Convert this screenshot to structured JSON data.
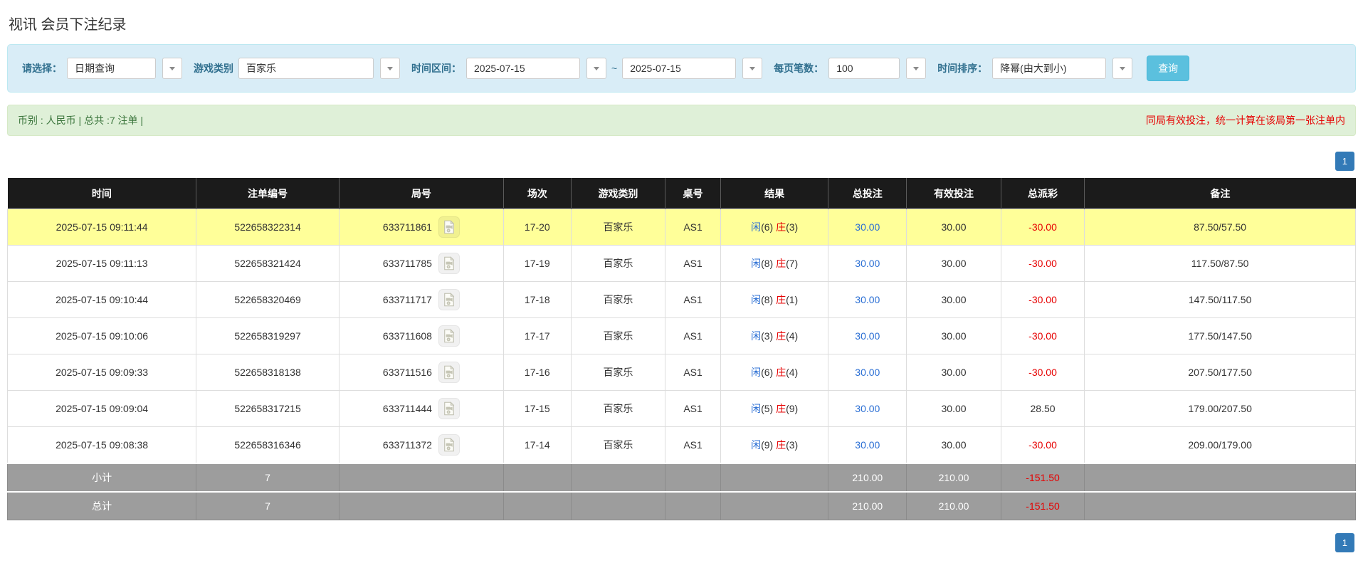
{
  "title": "视讯 会员下注纪录",
  "filters": {
    "select_label": "请选择：",
    "select_value": "日期查询",
    "game_label": "游戏类别",
    "game_value": "百家乐",
    "range_label": "时间区间：",
    "date_from": "2025-07-15",
    "range_separator": "~",
    "date_to": "2025-07-15",
    "per_page_label": "每页笔数：",
    "per_page_value": "100",
    "sort_label": "时间排序：",
    "sort_value": "降幂(由大到小)",
    "search_button": "查询"
  },
  "summary_bar": {
    "left": "币别 : 人民币 | 总共 :7 注单 |",
    "right": "同局有效投注，统一计算在该局第一张注单内"
  },
  "pagination": {
    "page": "1"
  },
  "table": {
    "headers": [
      "时间",
      "注单编号",
      "局号",
      "场次",
      "游戏类别",
      "桌号",
      "结果",
      "总投注",
      "有效投注",
      "总派彩",
      "备注"
    ],
    "rows": [
      {
        "time": "2025-07-15 09:11:44",
        "bet_no": "522658322314",
        "round_no": "633711861",
        "session": "17-20",
        "game": "百家乐",
        "table_no": "AS1",
        "result_player": "闲",
        "result_player_n": "(6)",
        "result_banker": "庄",
        "result_banker_n": "(3)",
        "total_bet": "30.00",
        "valid_bet": "30.00",
        "payout": "-30.00",
        "payout_negative": true,
        "remark": "87.50/57.50",
        "highlight": true
      },
      {
        "time": "2025-07-15 09:11:13",
        "bet_no": "522658321424",
        "round_no": "633711785",
        "session": "17-19",
        "game": "百家乐",
        "table_no": "AS1",
        "result_player": "闲",
        "result_player_n": "(8)",
        "result_banker": "庄",
        "result_banker_n": "(7)",
        "total_bet": "30.00",
        "valid_bet": "30.00",
        "payout": "-30.00",
        "payout_negative": true,
        "remark": "117.50/87.50",
        "highlight": false
      },
      {
        "time": "2025-07-15 09:10:44",
        "bet_no": "522658320469",
        "round_no": "633711717",
        "session": "17-18",
        "game": "百家乐",
        "table_no": "AS1",
        "result_player": "闲",
        "result_player_n": "(8)",
        "result_banker": "庄",
        "result_banker_n": "(1)",
        "total_bet": "30.00",
        "valid_bet": "30.00",
        "payout": "-30.00",
        "payout_negative": true,
        "remark": "147.50/117.50",
        "highlight": false
      },
      {
        "time": "2025-07-15 09:10:06",
        "bet_no": "522658319297",
        "round_no": "633711608",
        "session": "17-17",
        "game": "百家乐",
        "table_no": "AS1",
        "result_player": "闲",
        "result_player_n": "(3)",
        "result_banker": "庄",
        "result_banker_n": "(4)",
        "total_bet": "30.00",
        "valid_bet": "30.00",
        "payout": "-30.00",
        "payout_negative": true,
        "remark": "177.50/147.50",
        "highlight": false
      },
      {
        "time": "2025-07-15 09:09:33",
        "bet_no": "522658318138",
        "round_no": "633711516",
        "session": "17-16",
        "game": "百家乐",
        "table_no": "AS1",
        "result_player": "闲",
        "result_player_n": "(6)",
        "result_banker": "庄",
        "result_banker_n": "(4)",
        "total_bet": "30.00",
        "valid_bet": "30.00",
        "payout": "-30.00",
        "payout_negative": true,
        "remark": "207.50/177.50",
        "highlight": false
      },
      {
        "time": "2025-07-15 09:09:04",
        "bet_no": "522658317215",
        "round_no": "633711444",
        "session": "17-15",
        "game": "百家乐",
        "table_no": "AS1",
        "result_player": "闲",
        "result_player_n": "(5)",
        "result_banker": "庄",
        "result_banker_n": "(9)",
        "total_bet": "30.00",
        "valid_bet": "30.00",
        "payout": "28.50",
        "payout_negative": false,
        "remark": "179.00/207.50",
        "highlight": false
      },
      {
        "time": "2025-07-15 09:08:38",
        "bet_no": "522658316346",
        "round_no": "633711372",
        "session": "17-14",
        "game": "百家乐",
        "table_no": "AS1",
        "result_player": "闲",
        "result_player_n": "(9)",
        "result_banker": "庄",
        "result_banker_n": "(3)",
        "total_bet": "30.00",
        "valid_bet": "30.00",
        "payout": "-30.00",
        "payout_negative": true,
        "remark": "209.00/179.00",
        "highlight": false
      }
    ],
    "footer_rows": [
      {
        "label": "小计",
        "count": "7",
        "total_bet": "210.00",
        "valid_bet": "210.00",
        "payout": "-151.50",
        "payout_negative": true
      },
      {
        "label": "总计",
        "count": "7",
        "total_bet": "210.00",
        "valid_bet": "210.00",
        "payout": "-151.50",
        "payout_negative": true
      }
    ]
  },
  "icons": {
    "dropdown": "chevron-down-icon",
    "round_video": "video-file-icon"
  },
  "colors": {
    "accent_button": "#5bc0de",
    "link_blue": "#2b6fd4",
    "negative_red": "#e60000",
    "highlight_yellow": "#ffff99",
    "header_black": "#1b1b1b",
    "summary_gray": "#9d9d9d",
    "panel_blue": "#d9edf7",
    "bar_green": "#dff0d8",
    "pager_blue": "#337ab7"
  }
}
